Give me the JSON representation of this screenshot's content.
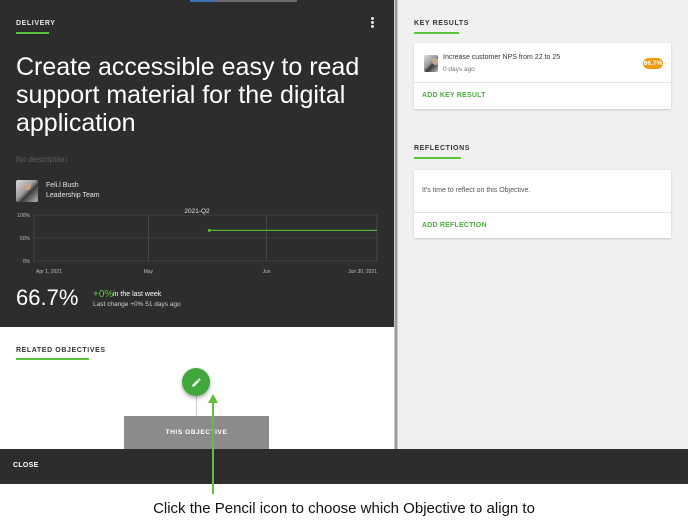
{
  "objective": {
    "section_label": "DELIVERY",
    "title": "Create accessible easy to read support material for the digital application",
    "description_placeholder": "No description",
    "owner_name": "Feli.l Bush",
    "owner_team": "Leadership Team"
  },
  "progress_chart": {
    "period": "2021-Q2",
    "y_ticks": [
      "100%",
      "50%",
      "0%"
    ],
    "x_ticks": [
      "Apr 1, 2021",
      "May",
      "Jun",
      "Jun 30, 2021"
    ]
  },
  "chart_data": {
    "type": "line",
    "title": "2021-Q2",
    "x_tick_labels": [
      "Apr 1, 2021",
      "May",
      "Jun",
      "Jun 30, 2021"
    ],
    "y_tick_labels": [
      "100%",
      "50%",
      "0%"
    ],
    "ylim": [
      0,
      100
    ],
    "grid": true,
    "series": [
      {
        "x": [
          "2021-05-17",
          "2021-06-30"
        ],
        "y": [
          66.7,
          66.7
        ]
      }
    ],
    "line_color": "#5cc33a"
  },
  "summary": {
    "percent": "66.7%",
    "delta": "+0%",
    "delta_suffix": "in the last week",
    "last_change": "Last change +0% 51 days ago"
  },
  "related": {
    "label": "RELATED OBJECTIVES",
    "this_objective": "THIS OBJECTIVE",
    "edit_icon": "pencil-icon"
  },
  "key_results": {
    "label": "KEY RESULTS",
    "items": [
      {
        "title": "Increase customer NPS from 22 to 25",
        "meta": "0 days ago",
        "progress_label": "66.7%",
        "progress": 0.667
      }
    ],
    "add_label": "ADD KEY RESULT"
  },
  "reflections": {
    "label": "REFLECTIONS",
    "prompt": "It's time to reflect on this Objective.",
    "add_label": "ADD REFLECTION"
  },
  "footer": {
    "close_label": "CLOSE"
  },
  "annotation": {
    "caption": "Click the Pencil icon to choose which Objective to align to"
  },
  "colors": {
    "accent_green": "#5cc33a",
    "fab_green": "#3fa83a",
    "dark_panel": "#2d2d2d",
    "badge_orange": "#f29a0c"
  }
}
